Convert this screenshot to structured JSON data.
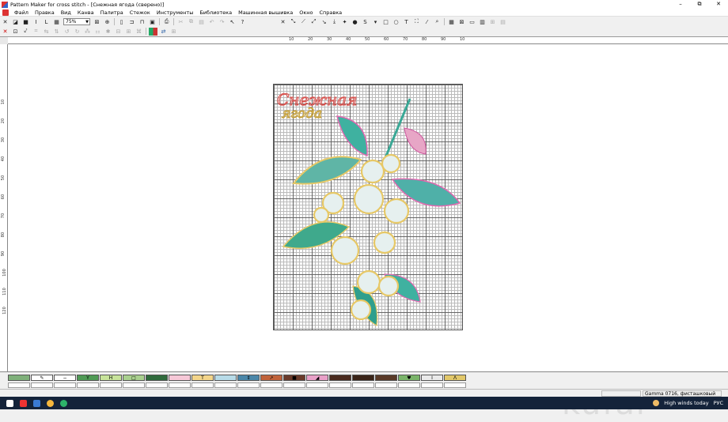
{
  "window": {
    "title": "Pattern Maker for cross stitch - [Снежная ягода (сверено)]",
    "minimize": "–",
    "restore": "⧉",
    "close": "✕"
  },
  "menu": [
    "Файл",
    "Правка",
    "Вид",
    "Канва",
    "Палитра",
    "Стежок",
    "Инструменты",
    "Библиотека",
    "Машинная вышивка",
    "Окно",
    "Справка"
  ],
  "toolbar": {
    "zoom_value": "75%"
  },
  "ruler": {
    "horizontal": [
      "10",
      "20",
      "30",
      "40",
      "50",
      "60",
      "70",
      "80",
      "90",
      "10"
    ],
    "vertical": [
      "10",
      "20",
      "30",
      "40",
      "50",
      "60",
      "70",
      "80",
      "90",
      "100",
      "110",
      "120"
    ]
  },
  "pattern": {
    "title_line1": "Снежная",
    "title_line2": "ягода"
  },
  "palette": [
    {
      "color": "#7fb07a",
      "symbol": ""
    },
    {
      "color": "#ffffff",
      "symbol": "✎"
    },
    {
      "color": "#ffffff",
      "symbol": "−"
    },
    {
      "color": "#4f9a55",
      "symbol": "Y"
    },
    {
      "color": "#c7e39a",
      "symbol": "H"
    },
    {
      "color": "#a9d08e",
      "symbol": "□"
    },
    {
      "color": "#2f6a3b",
      "symbol": ""
    },
    {
      "color": "#f6c8d7",
      "symbol": ""
    },
    {
      "color": "#f3d58a",
      "symbol": "T"
    },
    {
      "color": "#b7dbe8",
      "symbol": ""
    },
    {
      "color": "#4a86a8",
      "symbol": "⇕"
    },
    {
      "color": "#c0623a",
      "symbol": "↗"
    },
    {
      "color": "#6a3a2a",
      "symbol": "■"
    },
    {
      "color": "#e9a0c8",
      "symbol": "◢"
    },
    {
      "color": "#4a2a1e",
      "symbol": ""
    },
    {
      "color": "#3a2418",
      "symbol": ""
    },
    {
      "color": "#5a3a28",
      "symbol": ""
    },
    {
      "color": "#7ab46a",
      "symbol": "♥"
    },
    {
      "color": "#eaeaea",
      "symbol": "I"
    },
    {
      "color": "#e2c86a",
      "symbol": "Λ"
    }
  ],
  "status": {
    "thread": "Gamma   0716, фисташковый"
  },
  "taskbar": {
    "weather": "High winds today",
    "lang": "РУС"
  },
  "watermark": "kufar"
}
